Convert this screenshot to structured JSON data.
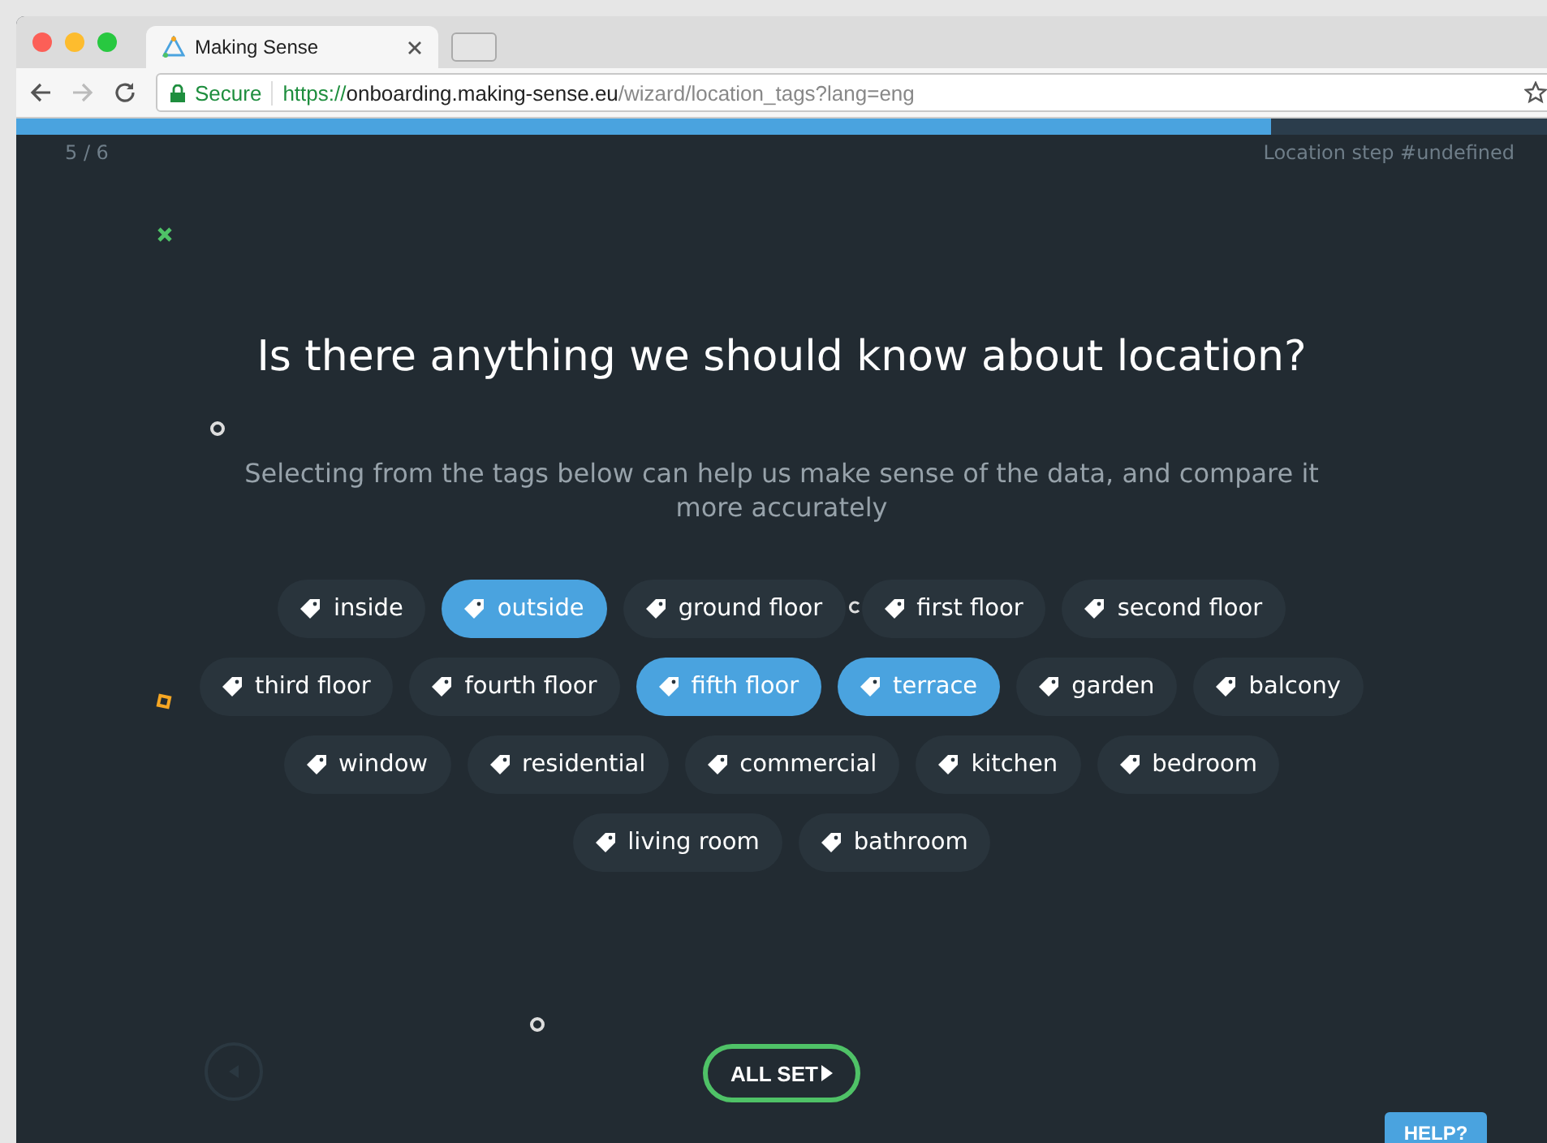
{
  "browser": {
    "tab_title": "Making Sense",
    "secure_label": "Secure",
    "url_scheme": "https://",
    "url_host": "onboarding.making-sense.eu",
    "url_path": "/wizard/location_tags?lang=eng"
  },
  "progress": {
    "level": 0.805
  },
  "step": {
    "counter": "5 / 6",
    "caption": "Location step #undefined"
  },
  "question": {
    "title": "Is there anything we should know about location?",
    "subtitle": "Selecting from the tags below can help us make sense of the data, and compare it more accurately"
  },
  "tags": [
    [
      {
        "label": "inside",
        "selected": false
      },
      {
        "label": "outside",
        "selected": true
      },
      {
        "label": "ground floor",
        "selected": false
      },
      {
        "label": "first floor",
        "selected": false
      },
      {
        "label": "second floor",
        "selected": false
      }
    ],
    [
      {
        "label": "third floor",
        "selected": false
      },
      {
        "label": "fourth floor",
        "selected": false
      },
      {
        "label": "fifth floor",
        "selected": true
      },
      {
        "label": "terrace",
        "selected": true
      },
      {
        "label": "garden",
        "selected": false
      },
      {
        "label": "balcony",
        "selected": false
      }
    ],
    [
      {
        "label": "window",
        "selected": false
      },
      {
        "label": "residential",
        "selected": false
      },
      {
        "label": "commercial",
        "selected": false
      },
      {
        "label": "kitchen",
        "selected": false
      },
      {
        "label": "bedroom",
        "selected": false
      }
    ],
    [
      {
        "label": "living room",
        "selected": false
      },
      {
        "label": "bathroom",
        "selected": false
      }
    ]
  ],
  "actions": {
    "next": "ALL SET",
    "help": "HELP?"
  }
}
